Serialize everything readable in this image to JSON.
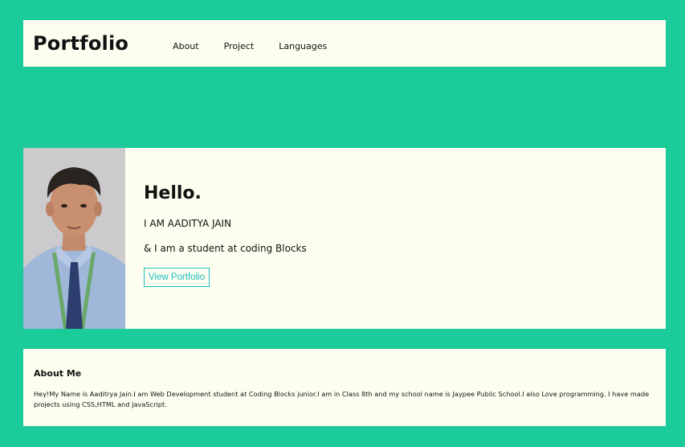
{
  "nav": {
    "brand": "Portfolio",
    "links": [
      "About",
      "Project",
      "Languages"
    ]
  },
  "hero": {
    "greeting": "Hello.",
    "name_line": "I AM AADITYA JAIN",
    "tagline": "& I am a student at coding Blocks",
    "cta_label": "View Portfolio"
  },
  "about": {
    "title": "About Me",
    "body": "Hey!My Name is Aaditrya Jain.I am Web Development student at Coding Blocks junior.I am in Class 8th and my school name is Jaypee Public School.I also Love programming. I have made projects using CSS,HTML and JavaScript."
  },
  "colors": {
    "background": "#1ccb9a",
    "card": "#fefef0",
    "accent": "#1cbfbf"
  }
}
